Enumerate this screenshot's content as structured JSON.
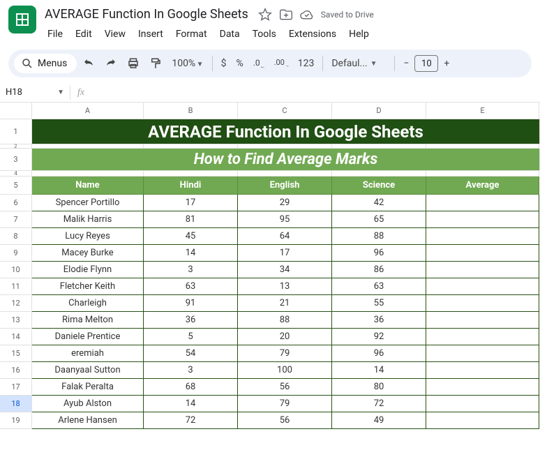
{
  "doc": {
    "title": "AVERAGE Function In Google Sheets",
    "saved": "Saved to Drive"
  },
  "menu": {
    "file": "File",
    "edit": "Edit",
    "view": "View",
    "insert": "Insert",
    "format": "Format",
    "data": "Data",
    "tools": "Tools",
    "extensions": "Extensions",
    "help": "Help"
  },
  "toolbar": {
    "menus": "Menus",
    "zoom": "100%",
    "currency": "$",
    "percent": "%",
    "dec_dec": ".0",
    "inc_dec": ".00",
    "num_fmt": "123",
    "font": "Defaul...",
    "font_size": "10",
    "minus": "−",
    "plus": "+"
  },
  "namebox": {
    "cell": "H18",
    "fx": "fx"
  },
  "columns": {
    "A": "A",
    "B": "B",
    "C": "C",
    "D": "D",
    "E": "E"
  },
  "row_nums": {
    "r1": "1",
    "r2": "2",
    "r3": "3",
    "r4": "4",
    "r5": "5",
    "r6": "6",
    "r7": "7",
    "r8": "8",
    "r9": "9",
    "r10": "10",
    "r11": "11",
    "r12": "12",
    "r13": "13",
    "r14": "14",
    "r15": "15",
    "r16": "16",
    "r17": "17",
    "r18": "18",
    "r19": "19"
  },
  "banner1": "AVERAGE Function In Google Sheets",
  "banner2": "How to Find Average Marks",
  "headers": {
    "name": "Name",
    "hindi": "Hindi",
    "english": "English",
    "science": "Science",
    "average": "Average"
  },
  "rows": [
    {
      "name": "Spencer Portillo",
      "hindi": "17",
      "english": "29",
      "science": "42",
      "average": ""
    },
    {
      "name": "Malik Harris",
      "hindi": "81",
      "english": "95",
      "science": "65",
      "average": ""
    },
    {
      "name": "Lucy Reyes",
      "hindi": "45",
      "english": "64",
      "science": "88",
      "average": ""
    },
    {
      "name": "Macey Burke",
      "hindi": "14",
      "english": "17",
      "science": "96",
      "average": ""
    },
    {
      "name": "Elodie Flynn",
      "hindi": "3",
      "english": "34",
      "science": "86",
      "average": ""
    },
    {
      "name": "Fletcher Keith",
      "hindi": "63",
      "english": "13",
      "science": "63",
      "average": ""
    },
    {
      "name": "Charleigh",
      "hindi": "91",
      "english": "21",
      "science": "55",
      "average": ""
    },
    {
      "name": "Rima Melton",
      "hindi": "36",
      "english": "88",
      "science": "36",
      "average": ""
    },
    {
      "name": "Daniele Prentice",
      "hindi": "5",
      "english": "20",
      "science": "92",
      "average": ""
    },
    {
      "name": "eremiah",
      "hindi": "54",
      "english": "79",
      "science": "96",
      "average": ""
    },
    {
      "name": "Daanyaal Sutton",
      "hindi": "3",
      "english": "100",
      "science": "14",
      "average": ""
    },
    {
      "name": "Falak Peralta",
      "hindi": "68",
      "english": "56",
      "science": "80",
      "average": ""
    },
    {
      "name": "Ayub Alston",
      "hindi": "14",
      "english": "79",
      "science": "72",
      "average": ""
    },
    {
      "name": "Arlene Hansen",
      "hindi": "72",
      "english": "56",
      "science": "49",
      "average": ""
    }
  ]
}
